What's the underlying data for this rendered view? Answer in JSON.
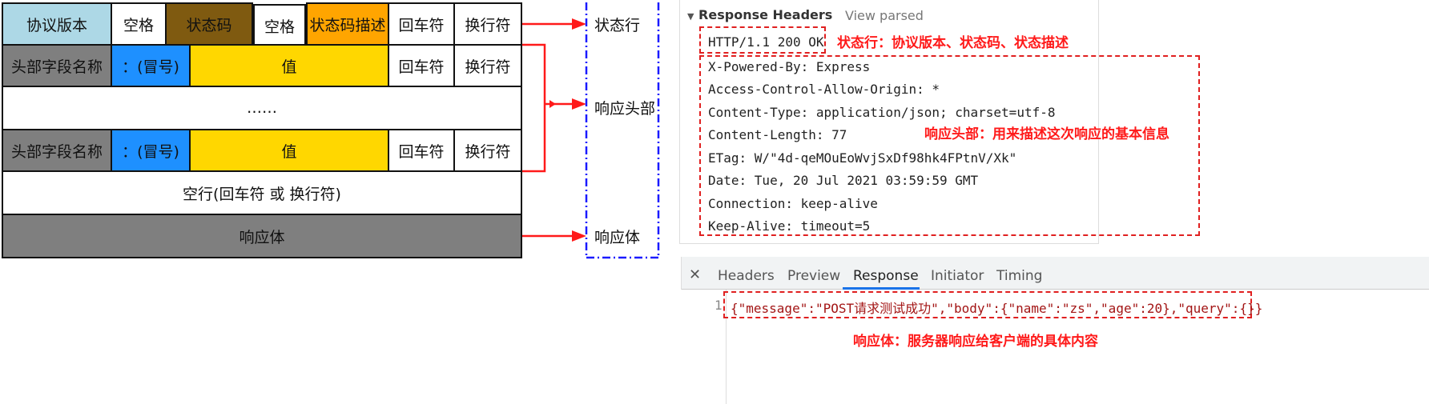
{
  "diagram": {
    "row1": [
      "协议版本",
      "空格",
      "状态码",
      "空格",
      "状态码描述",
      "回车符",
      "换行符"
    ],
    "row2": [
      "头部字段名称",
      "：(冒号)",
      "值",
      "回车符",
      "换行符"
    ],
    "row3": "……",
    "row4": [
      "头部字段名称",
      "：(冒号)",
      "值",
      "回车符",
      "换行符"
    ],
    "row5": "空行(回车符 或 换行符)",
    "row6": "响应体",
    "labels": {
      "status_line": "状态行",
      "headers": "响应头部",
      "body": "响应体"
    }
  },
  "devtools": {
    "section_title": "Response Headers",
    "view_parsed": "View parsed",
    "status_line": "HTTP/1.1 200 OK",
    "headers": [
      "X-Powered-By: Express",
      "Access-Control-Allow-Origin: *",
      "Content-Type: application/json; charset=utf-8",
      "Content-Length: 77",
      "ETag: W/\"4d-qeMOuEoWvjSxDf98hk4FPtnV/Xk\"",
      "Date: Tue, 20 Jul 2021 03:59:59 GMT",
      "Connection: keep-alive",
      "Keep-Alive: timeout=5"
    ],
    "note_status": "状态行：协议版本、状态码、状态描述",
    "note_headers": "响应头部：用来描述这次响应的基本信息",
    "tabs": [
      "Headers",
      "Preview",
      "Response",
      "Initiator",
      "Timing"
    ],
    "active_tab": "Response",
    "line_number": "1",
    "response_body": "{\"message\":\"POST请求测试成功\",\"body\":{\"name\":\"zs\",\"age\":20},\"query\":{}}",
    "note_body": "响应体：服务器响应给客户端的具体内容"
  },
  "colors": {
    "light_blue": "#add8e6",
    "brown": "#7f5a10",
    "orange": "#ffa500",
    "gray": "#7f7f7f",
    "blue": "#1e90ff",
    "yellow": "#ffd700",
    "red": "#ff1a1a"
  }
}
